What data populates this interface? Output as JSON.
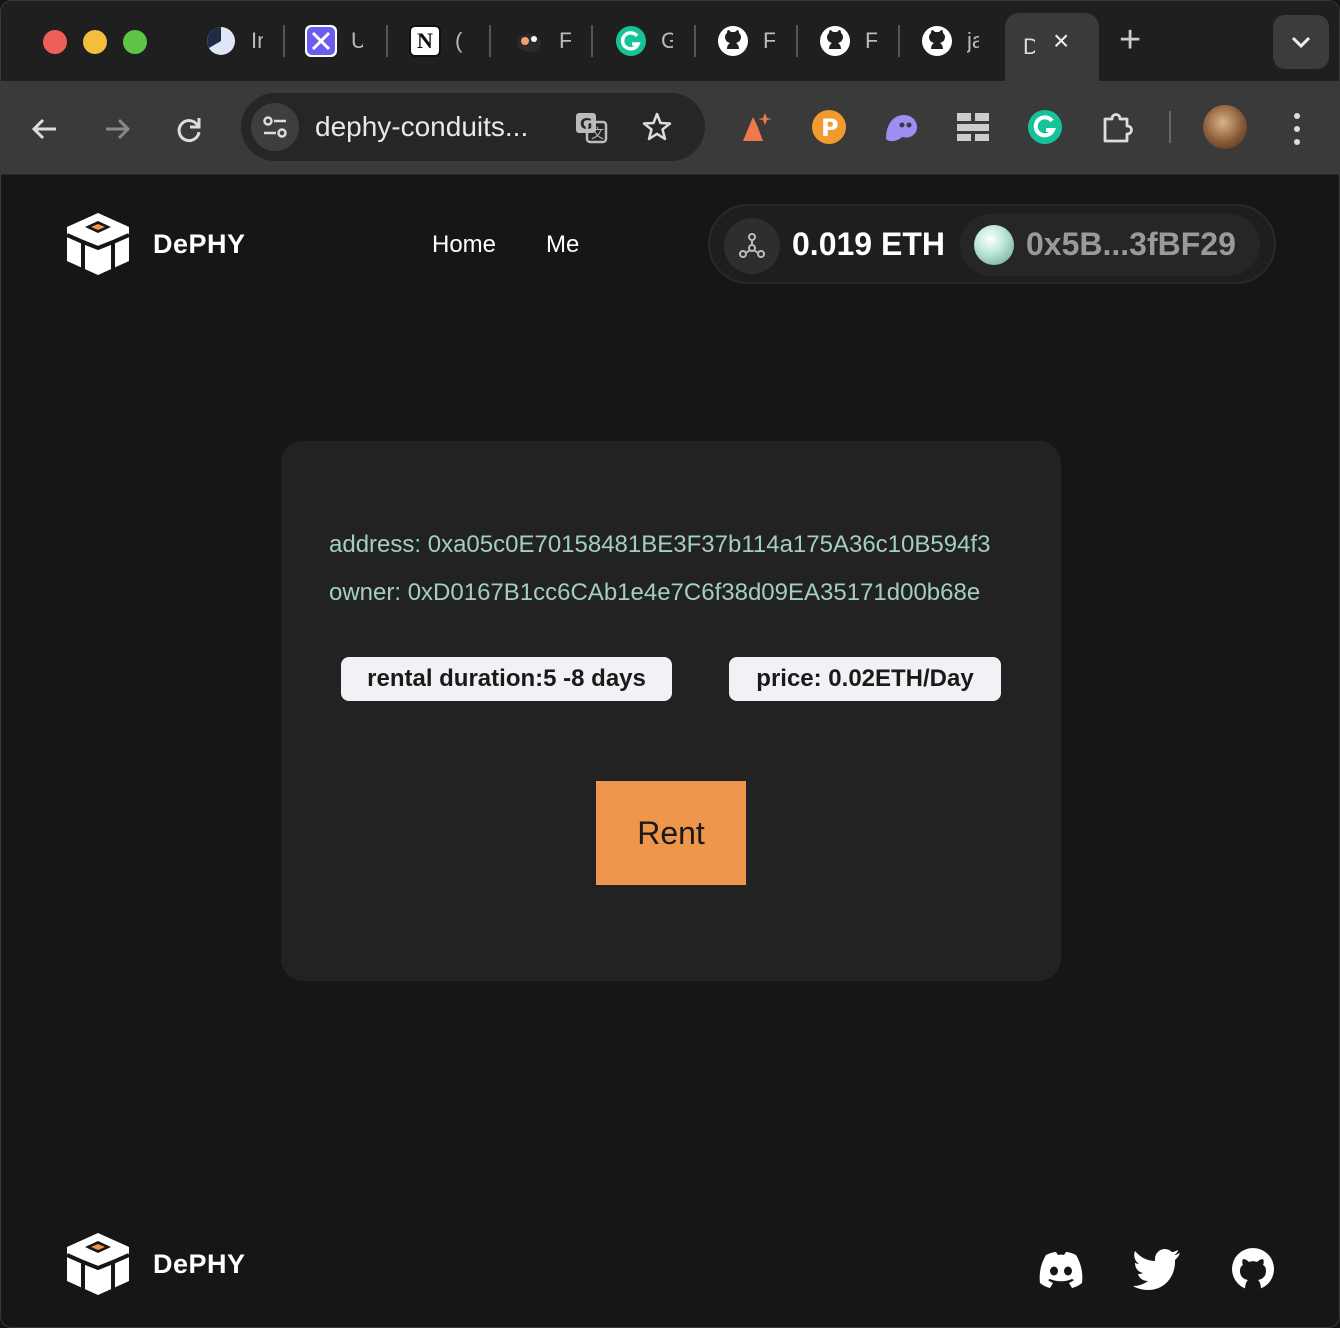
{
  "browser": {
    "tabs": [
      {
        "title": "In",
        "icon": "pie-chart-icon",
        "color": "#dfe6f5"
      },
      {
        "title": "U",
        "icon": "linear-app-icon",
        "color": "#7a6cf0"
      },
      {
        "title": "(",
        "icon": "notion-icon",
        "color": "#ffffff"
      },
      {
        "title": "F",
        "icon": "mascot-icon",
        "color": "#f0a070"
      },
      {
        "title": "G",
        "icon": "grammarly-icon",
        "color": "#15c39a"
      },
      {
        "title": "F",
        "icon": "github-icon",
        "color": "#ffffff"
      },
      {
        "title": "F",
        "icon": "github-icon",
        "color": "#ffffff"
      },
      {
        "title": "ja",
        "icon": "github-icon",
        "color": "#ffffff"
      }
    ],
    "active_tab": {
      "title": "D"
    },
    "url": "dephy-conduits...",
    "extensions": [
      "ai-spark-icon",
      "p-coin-icon",
      "ghost-icon",
      "grid-icon",
      "grammarly-icon",
      "puzzle-icon"
    ],
    "colors": {
      "tabstrip": "#1f1f1f",
      "toolbar": "#3a3a3a"
    }
  },
  "header": {
    "brand": "DePHY",
    "nav": [
      "Home",
      "Me"
    ],
    "wallet": {
      "balance": "0.019 ETH",
      "address": "0x5B...3fBF29"
    }
  },
  "card": {
    "address_line": "address: 0xa05c0E70158481BE3F37b114a175A36c10B594f3",
    "owner_line": "owner: 0xD0167B1cc6CAb1e4e7C6f38d09EA35171d00b68e",
    "rental_duration": "rental duration:5 -8 days",
    "price": "price: 0.02ETH/Day",
    "rent_label": "Rent"
  },
  "footer": {
    "brand": "DePHY",
    "social": [
      "discord-icon",
      "twitter-icon",
      "github-icon"
    ]
  },
  "colors": {
    "accent": "#ee964b",
    "info_text": "#a3d0bd",
    "card_bg": "#222222",
    "page_bg": "#161616"
  }
}
